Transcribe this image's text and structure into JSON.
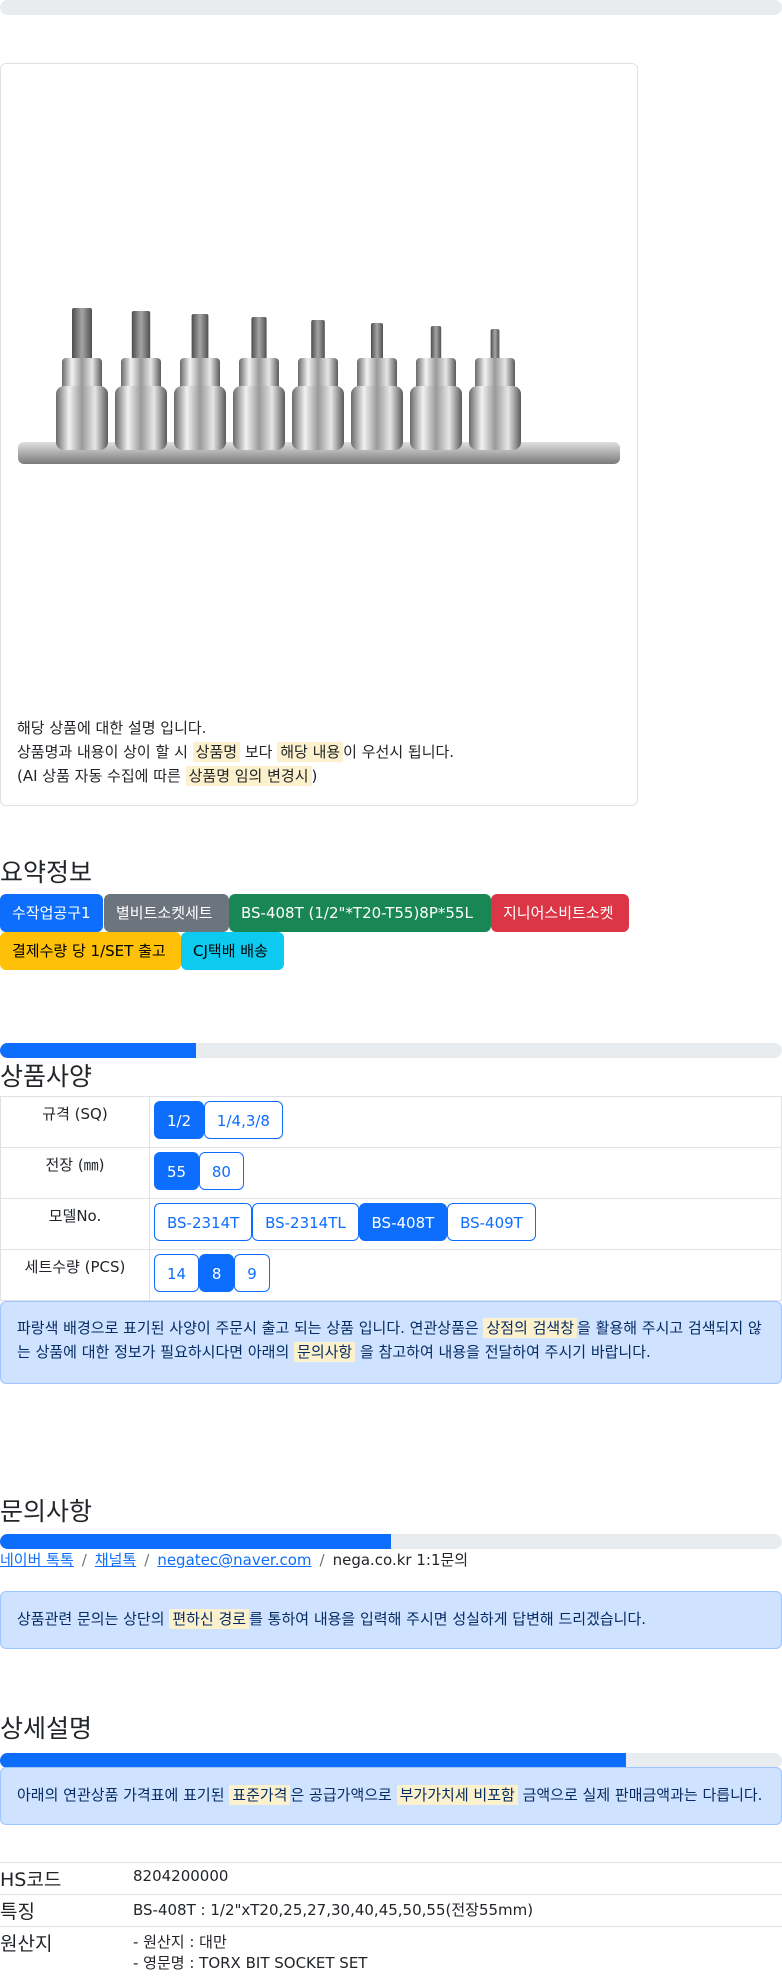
{
  "product_description": {
    "line1": "해당 상품에 대한 설명 입니다.",
    "line2_a": "상품명과 내용이 상이 할 시 ",
    "line2_mark1": "상품명",
    "line2_b": " 보다 ",
    "line2_mark2": "해당 내용",
    "line2_c": "이 우선시 됩니다.",
    "line3_a": "(AI 상품 자동 수집에 따른 ",
    "line3_mark": "상품명 임의 변경시",
    "line3_b": ")"
  },
  "summary": {
    "title": "요약정보",
    "badges": [
      "수작업공구1",
      "별비트소켓세트",
      "BS-408T (1/2\"*T20-T55)8P*55L",
      "지니어스비트소켓",
      "결제수량 당 1/SET 출고",
      "CJ택배 배송"
    ]
  },
  "spec": {
    "title": "상품사양",
    "progress": 0.25,
    "rows": [
      {
        "label": "규격 (SQ)",
        "options": [
          "1/2",
          "1/4,3/8"
        ],
        "selected": 0
      },
      {
        "label": "전장 (㎜)",
        "options": [
          "55",
          "80"
        ],
        "selected": 0
      },
      {
        "label": "모델No.",
        "options": [
          "BS-2314T",
          "BS-2314TL",
          "BS-408T",
          "BS-409T"
        ],
        "selected": 2
      },
      {
        "label": "세트수량 (PCS)",
        "options": [
          "14",
          "8",
          "9"
        ],
        "selected": 1
      }
    ],
    "notice_a": "파랑색 배경으로 표기된 사양이 주문시 출고 되는 상품 입니다. 연관상품은 ",
    "notice_mark1": "상점의 검색창",
    "notice_b": "을 활용해 주시고 검색되지 않는 상품에 대한 정보가 필요하시다면 아래의 ",
    "notice_mark2": "문의사항",
    "notice_c": " 을 참고하여 내용을 전달하여 주시기 바랍니다."
  },
  "inquiry": {
    "title": "문의사항",
    "progress": 0.5,
    "links": [
      "네이버 톡톡",
      "채널톡",
      "negatec@naver.com"
    ],
    "plain": "nega.co.kr 1:1문의",
    "separator": "/",
    "notice_a": "상품관련 문의는 상단의 ",
    "notice_mark": "편하신 경로",
    "notice_b": "를 통하여 내용을 입력해 주시면 성실하게 답변해 드리겠습니다."
  },
  "detail": {
    "title": "상세설명",
    "progress": 0.8,
    "notice_a": "아래의 연관상품 가격표에 표기된 ",
    "notice_mark1": "표준가격",
    "notice_b": "은 공급가액으로 ",
    "notice_mark2": "부가가치세 비포함",
    "notice_c": " 금액으로 실제 판매금액과는 다릅니다.",
    "info": [
      {
        "key": "HS코드",
        "value": "8204200000"
      },
      {
        "key": "특징",
        "value": "BS-408T : 1/2\"xT20,25,27,30,40,45,50,55(전장55mm)"
      },
      {
        "key": "원산지",
        "value1": "- 원산지 : 대만",
        "value2": "- 영문명 : TORX BIT SOCKET SET"
      }
    ]
  },
  "colors": {
    "primary": "#0d6efd",
    "highlight": "#fcf1cd",
    "alert_bg": "#cfe2ff"
  }
}
